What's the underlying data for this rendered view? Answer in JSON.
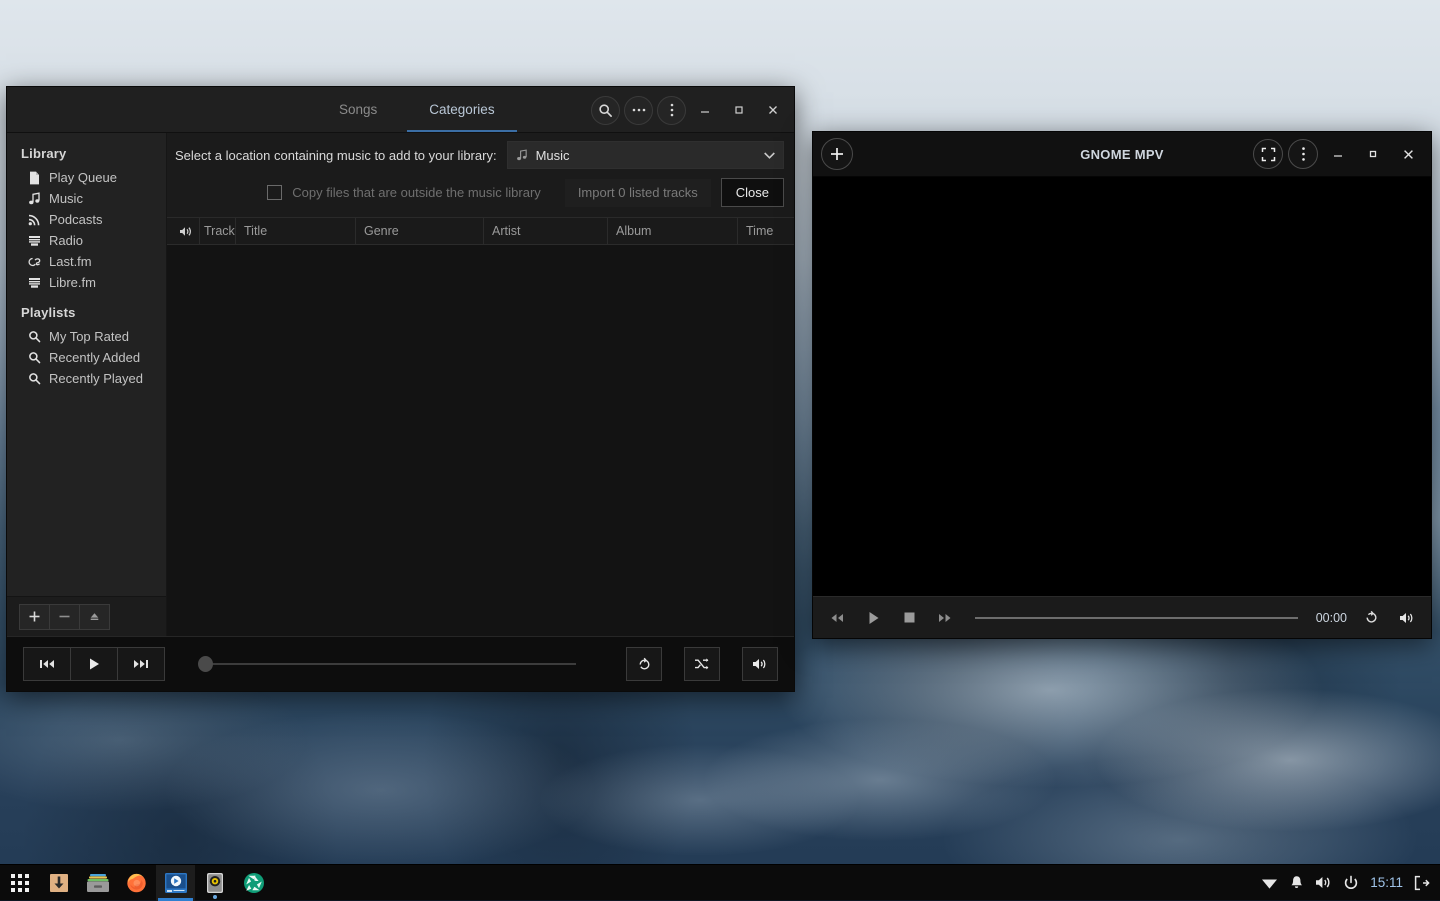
{
  "desktop": {
    "wallpaper_description": "misty-forest-wallpaper"
  },
  "music_window": {
    "tabs": [
      {
        "label": "Songs",
        "active": false
      },
      {
        "label": "Categories",
        "active": true
      }
    ],
    "header_buttons": [
      {
        "name": "search-icon",
        "label": "search"
      },
      {
        "name": "more-horizontal-icon",
        "label": "•••"
      },
      {
        "name": "menu-kebab-icon",
        "label": "⋮"
      }
    ],
    "window_controls": {
      "minimize": "–",
      "maximize": "□",
      "close": "✕"
    },
    "sidebar": {
      "library_header": "Library",
      "library_items": [
        {
          "icon": "file-icon",
          "label": "Play Queue"
        },
        {
          "icon": "music-note-icon",
          "label": "Music"
        },
        {
          "icon": "rss-icon",
          "label": "Podcasts"
        },
        {
          "icon": "radio-icon",
          "label": "Radio"
        },
        {
          "icon": "lastfm-icon",
          "label": "Last.fm"
        },
        {
          "icon": "librefm-icon",
          "label": "Libre.fm"
        }
      ],
      "playlists_header": "Playlists",
      "playlist_items": [
        {
          "icon": "search-icon",
          "label": "My Top Rated"
        },
        {
          "icon": "search-icon",
          "label": "Recently Added"
        },
        {
          "icon": "search-icon",
          "label": "Recently Played"
        }
      ],
      "tools": [
        {
          "name": "add-source-button",
          "glyph": "＋"
        },
        {
          "name": "remove-source-button",
          "glyph": "—"
        },
        {
          "name": "eject-source-button",
          "glyph": "⏏"
        }
      ]
    },
    "import_bar": {
      "prompt": "Select a location containing music to add to your library:",
      "location_value": "Music",
      "location_icon": "music-note-icon",
      "copy_checkbox_label": "Copy files that are outside the music library",
      "copy_checkbox_checked": false,
      "import_button": "Import 0 listed tracks",
      "close_button": "Close"
    },
    "track_table": {
      "columns": [
        "Track",
        "Title",
        "Genre",
        "Artist",
        "Album",
        "Time"
      ],
      "speaker_column_icon": "speaker-icon",
      "rows": []
    },
    "player": {
      "previous_icon": "previous-track-icon",
      "play_icon": "play-icon",
      "next_icon": "next-track-icon",
      "seek_position_percent": 0,
      "repeat_icon": "repeat-icon",
      "shuffle_icon": "shuffle-icon",
      "volume_icon": "volume-icon"
    }
  },
  "mpv_window": {
    "title": "GNOME MPV",
    "open_button_icon": "plus-icon",
    "header_buttons": [
      {
        "name": "fullscreen-icon",
        "label": "fullscreen"
      },
      {
        "name": "menu-kebab-icon",
        "label": "⋮"
      }
    ],
    "window_controls": {
      "minimize": "–",
      "maximize": "□",
      "close": "✕"
    },
    "controls": {
      "rewind_icon": "rewind-icon",
      "play_icon": "play-icon",
      "stop_icon": "stop-icon",
      "forward_icon": "fast-forward-icon",
      "seek_position_percent": 0,
      "time": "00:00",
      "loop_icon": "loop-icon",
      "volume_icon": "volume-icon"
    }
  },
  "taskbar": {
    "launchers": [
      {
        "name": "app-grid-icon",
        "label": "Applications",
        "state": "normal"
      },
      {
        "name": "downloads-icon",
        "label": "Downloads",
        "state": "normal"
      },
      {
        "name": "file-manager-icon",
        "label": "Files",
        "state": "normal"
      },
      {
        "name": "firefox-icon",
        "label": "Firefox",
        "state": "normal"
      },
      {
        "name": "mpv-icon",
        "label": "GNOME MPV",
        "state": "active"
      },
      {
        "name": "lollypop-icon",
        "label": "Music",
        "state": "running"
      },
      {
        "name": "shutter-icon",
        "label": "Shutter",
        "state": "normal"
      }
    ],
    "tray": [
      {
        "name": "wifi-icon",
        "label": "Network"
      },
      {
        "name": "bell-icon",
        "label": "Notifications"
      },
      {
        "name": "volume-icon",
        "label": "Volume"
      },
      {
        "name": "power-icon",
        "label": "Power"
      }
    ],
    "clock": "15:11",
    "logout_icon": "logout-icon"
  }
}
